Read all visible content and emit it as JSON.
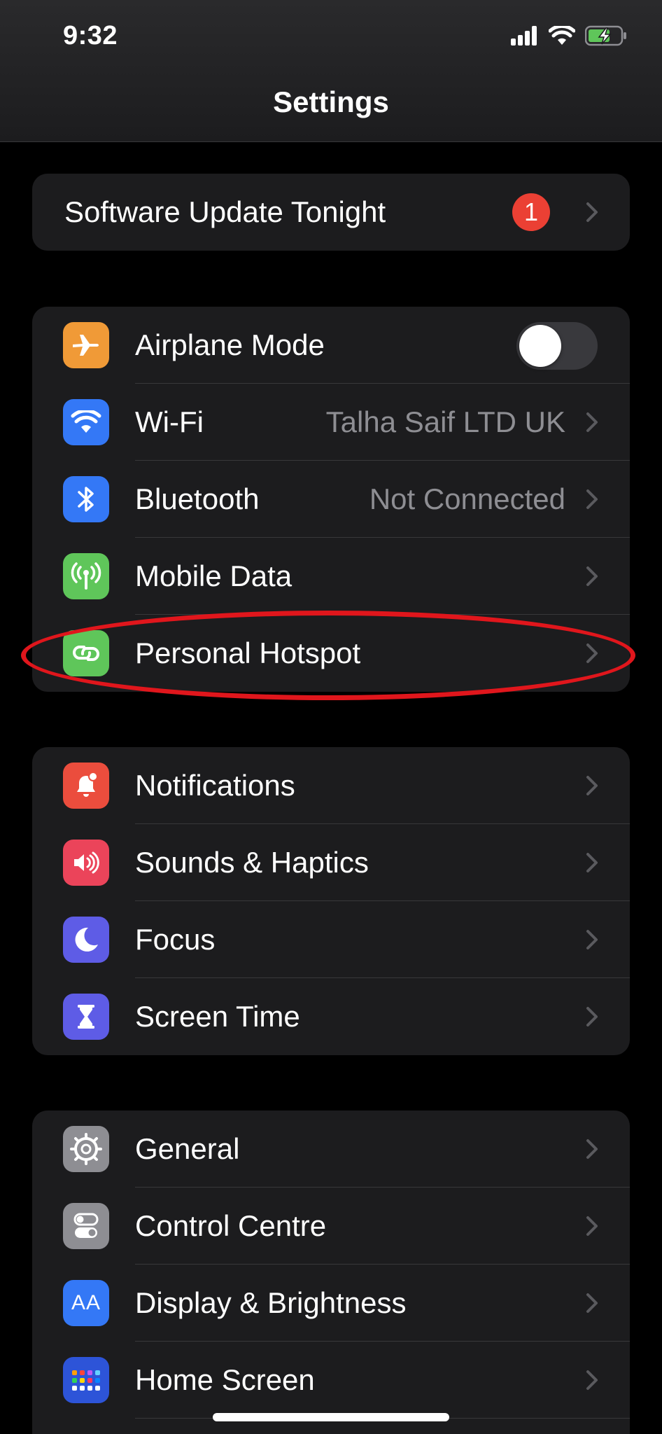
{
  "status_bar": {
    "time": "9:32",
    "signal_icon": "signal-bars-icon",
    "wifi_icon": "wifi-icon",
    "battery_icon": "battery-charging-icon"
  },
  "header": {
    "title": "Settings"
  },
  "update_banner": {
    "label": "Software Update Tonight",
    "badge": "1"
  },
  "group1": {
    "items": [
      {
        "label": "Airplane Mode",
        "icon": "airplane-icon",
        "color": "#f09a37",
        "toggle": "off"
      },
      {
        "label": "Wi-Fi",
        "value": "Talha Saif LTD UK",
        "icon": "wifi-icon",
        "color": "#3478f6"
      },
      {
        "label": "Bluetooth",
        "value": "Not Connected",
        "icon": "bluetooth-icon",
        "color": "#3478f6"
      },
      {
        "label": "Mobile Data",
        "icon": "antenna-icon",
        "color": "#5fc65a"
      },
      {
        "label": "Personal Hotspot",
        "icon": "hotspot-link-icon",
        "color": "#5fc65a",
        "highlighted": true
      }
    ]
  },
  "group2": {
    "items": [
      {
        "label": "Notifications",
        "icon": "bell-icon",
        "color": "#eb4d3d"
      },
      {
        "label": "Sounds & Haptics",
        "icon": "speaker-icon",
        "color": "#eb445a"
      },
      {
        "label": "Focus",
        "icon": "moon-icon",
        "color": "#5e5ce6"
      },
      {
        "label": "Screen Time",
        "icon": "hourglass-icon",
        "color": "#5e5ce6"
      }
    ]
  },
  "group3": {
    "items": [
      {
        "label": "General",
        "icon": "gear-icon",
        "color": "#8e8e93"
      },
      {
        "label": "Control Centre",
        "icon": "switches-icon",
        "color": "#8e8e93"
      },
      {
        "label": "Display & Brightness",
        "icon": "text-size-icon",
        "icon_text": "AA",
        "color": "#3478f6"
      },
      {
        "label": "Home Screen",
        "icon": "app-grid-icon",
        "color": "#2d54d8"
      }
    ]
  },
  "colors": {
    "annotation": "#e0161c",
    "group_background": "#1c1c1e",
    "separator": "#38383a",
    "secondary_text": "#8e8e93"
  }
}
